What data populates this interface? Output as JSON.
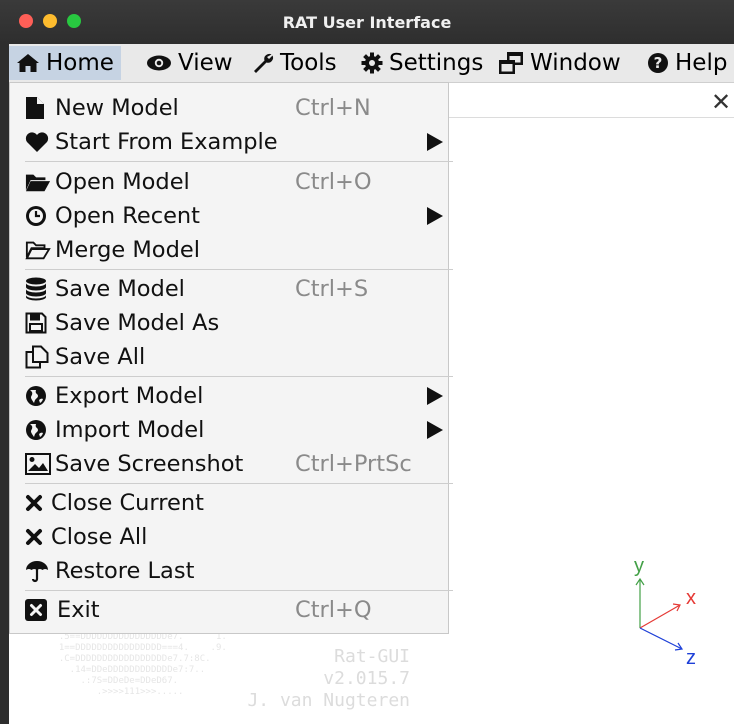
{
  "window": {
    "title": "RAT User Interface"
  },
  "menubar": {
    "home": "Home",
    "view": "View",
    "tools": "Tools",
    "settings": "Settings",
    "window": "Window",
    "help": "Help"
  },
  "dropdown": {
    "items": [
      {
        "label": "New Model",
        "shortcut": "Ctrl+N",
        "icon": "file-icon"
      },
      {
        "label": "Start From Example",
        "shortcut": "",
        "icon": "heart-icon",
        "submenu": true
      },
      {
        "label": "Open Model",
        "shortcut": "Ctrl+O",
        "icon": "folder-open-icon"
      },
      {
        "label": "Open Recent",
        "shortcut": "",
        "icon": "clock-icon",
        "submenu": true
      },
      {
        "label": "Merge Model",
        "shortcut": "",
        "icon": "folder-outline-icon"
      },
      {
        "label": "Save Model",
        "shortcut": "Ctrl+S",
        "icon": "database-icon"
      },
      {
        "label": "Save Model As",
        "shortcut": "",
        "icon": "floppy-icon"
      },
      {
        "label": "Save All",
        "shortcut": "",
        "icon": "copy-icon"
      },
      {
        "label": "Export Model",
        "shortcut": "",
        "icon": "globe-icon",
        "submenu": true
      },
      {
        "label": "Import Model",
        "shortcut": "",
        "icon": "globe-icon",
        "submenu": true
      },
      {
        "label": "Save Screenshot",
        "shortcut": "Ctrl+PrtSc",
        "icon": "image-icon"
      },
      {
        "label": "Close Current",
        "shortcut": "",
        "icon": "x-icon"
      },
      {
        "label": "Close All",
        "shortcut": "",
        "icon": "x-icon"
      },
      {
        "label": "Restore Last",
        "shortcut": "",
        "icon": "umbrella-icon"
      },
      {
        "label": "Exit",
        "shortcut": "Ctrl+Q",
        "icon": "exit-box-icon"
      }
    ]
  },
  "logo": {
    "line1": "Rat-GUI",
    "line2": "v2.015.7",
    "line3": "J. van Nugteren"
  },
  "axes": {
    "x": "x",
    "y": "y",
    "z": "z"
  },
  "colors": {
    "axis_x": "#e53935",
    "axis_y": "#43a047",
    "axis_z": "#1e40d8",
    "menu_highlight": "#c6d3e3"
  }
}
